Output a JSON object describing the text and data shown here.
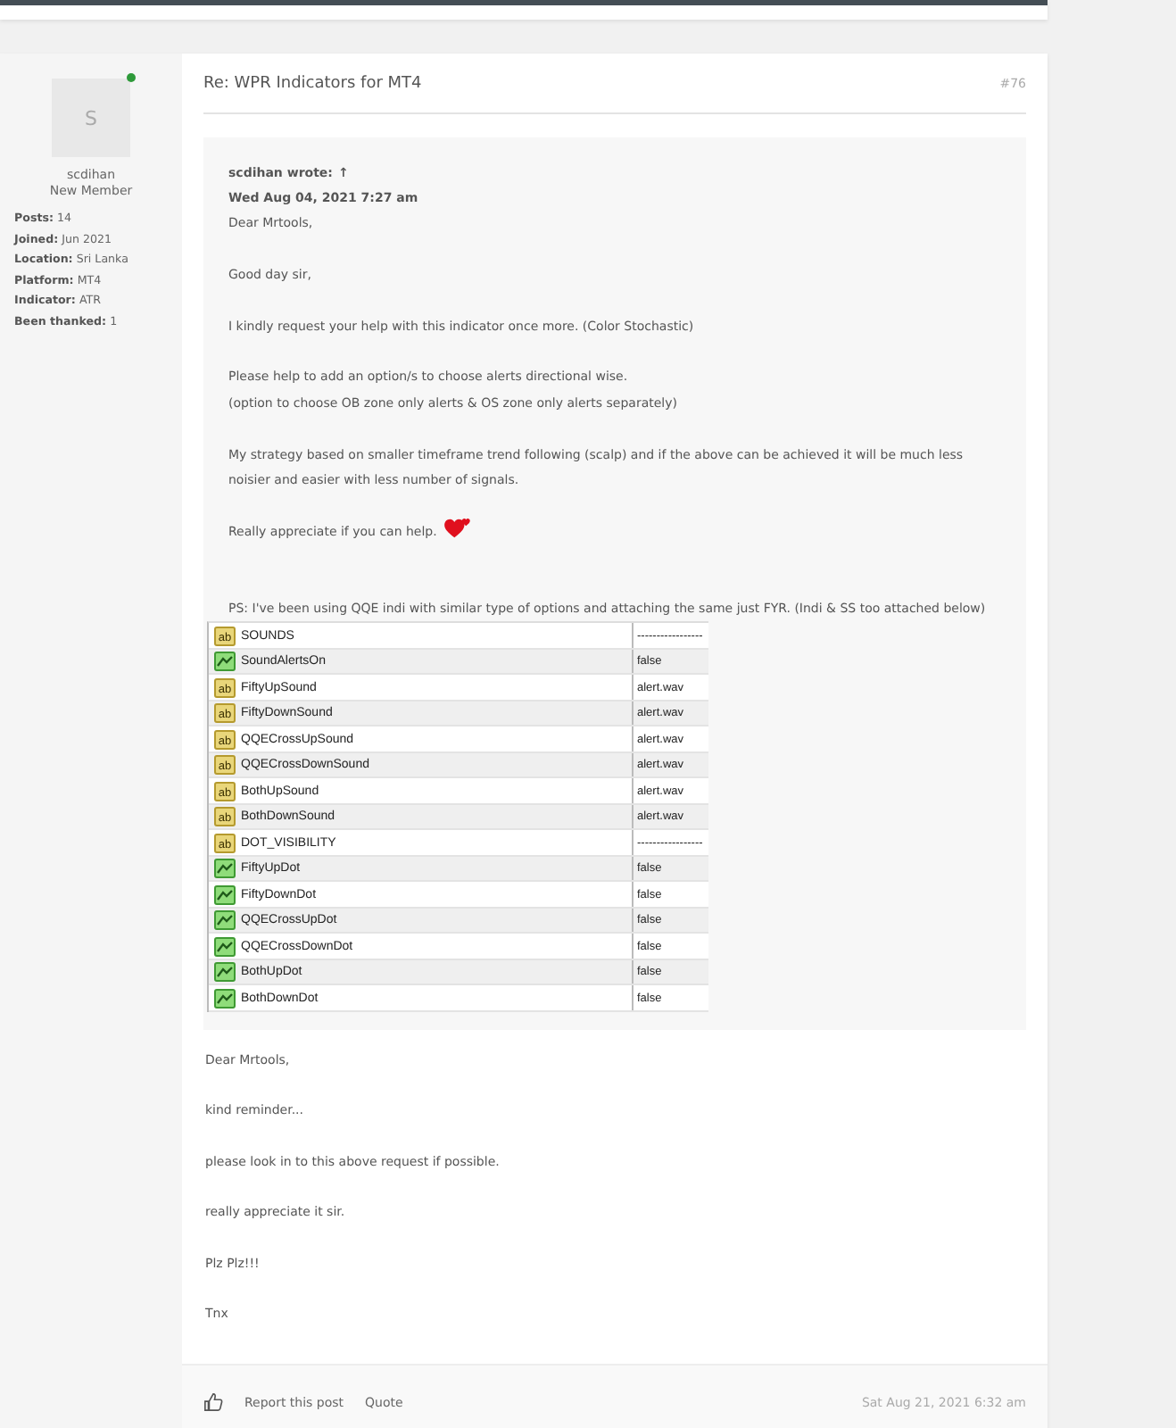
{
  "post": {
    "title": "Re: WPR Indicators for MT4",
    "number": "#76",
    "author": {
      "avatar_letter": "S",
      "online": true,
      "name": "scdihan",
      "rank": "New Member",
      "profile": [
        {
          "label": "Posts:",
          "value": "14"
        },
        {
          "label": "Joined:",
          "value": "Jun 2021"
        },
        {
          "label": "Location:",
          "value": "Sri Lanka"
        },
        {
          "label": "Platform:",
          "value": "MT4"
        },
        {
          "label": "Indicator:",
          "value": "ATR"
        },
        {
          "label": "Been thanked:",
          "value": "1"
        }
      ]
    },
    "quote": {
      "author": "scdihan wrote:",
      "link": "↑",
      "date": "Wed Aug 04, 2021 7:27 am",
      "paragraphs": [
        {
          "lines": [
            "Dear Mrtools,"
          ],
          "gap": false
        },
        {
          "lines": [
            "Good day sir,"
          ],
          "gap": false
        },
        {
          "lines": [
            "I kindly request your help with this indicator once more. (Color Stochastic)"
          ],
          "gap": false
        },
        {
          "lines": [
            "Please help to add an option/s to choose alerts directional wise.",
            "(option to choose OB zone only alerts & OS zone only alerts separately)"
          ],
          "gap": false
        },
        {
          "lines": [
            "My strategy based on smaller timeframe trend following (scalp) and if the above can be achieved it will be much less noisier and easier with less number of signals."
          ],
          "gap": false
        },
        {
          "lines": [
            "Really appreciate if you can help."
          ],
          "heart": true,
          "gap": true
        },
        {
          "lines": [
            "PS: I've been using QQE indi with similar type of options and attaching the same just FYR. (Indi & SS too attached below)"
          ],
          "gap": false
        }
      ],
      "settings": [
        {
          "kind": "text",
          "icon_label": "ab",
          "name": "SOUNDS",
          "value": "-----------------"
        },
        {
          "kind": "bool",
          "name": "SoundAlertsOn",
          "value": "false"
        },
        {
          "kind": "text",
          "icon_label": "ab",
          "name": "FiftyUpSound",
          "value": "alert.wav"
        },
        {
          "kind": "text",
          "icon_label": "ab",
          "name": "FiftyDownSound",
          "value": "alert.wav"
        },
        {
          "kind": "text",
          "icon_label": "ab",
          "name": "QQECrossUpSound",
          "value": "alert.wav"
        },
        {
          "kind": "text",
          "icon_label": "ab",
          "name": "QQECrossDownSound",
          "value": "alert.wav"
        },
        {
          "kind": "text",
          "icon_label": "ab",
          "name": "BothUpSound",
          "value": "alert.wav"
        },
        {
          "kind": "text",
          "icon_label": "ab",
          "name": "BothDownSound",
          "value": "alert.wav"
        },
        {
          "kind": "text",
          "icon_label": "ab",
          "name": "DOT_VISIBILITY",
          "value": "-----------------"
        },
        {
          "kind": "bool",
          "name": "FiftyUpDot",
          "value": "false"
        },
        {
          "kind": "bool",
          "name": "FiftyDownDot",
          "value": "false"
        },
        {
          "kind": "bool",
          "name": "QQECrossUpDot",
          "value": "false"
        },
        {
          "kind": "bool",
          "name": "QQECrossDownDot",
          "value": "false"
        },
        {
          "kind": "bool",
          "name": "BothUpDot",
          "value": "false"
        },
        {
          "kind": "bool",
          "name": "BothDownDot",
          "value": "false"
        }
      ]
    },
    "body": [
      "Dear Mrtools,",
      "kind reminder...",
      "please look in to this above request if possible.",
      "really appreciate it sir.",
      "Plz Plz!!!",
      "Tnx"
    ],
    "footer": {
      "actions": [
        "Report this post",
        "Quote"
      ],
      "date": "Sat Aug 21, 2021 6:32 am"
    }
  }
}
